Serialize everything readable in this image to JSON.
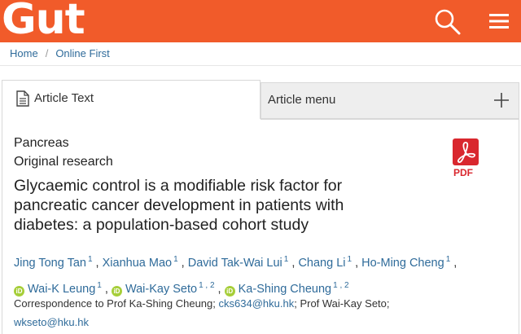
{
  "header": {
    "logo_text": "Gut",
    "brand_color": "#f15b2a",
    "icons": [
      "search-icon",
      "menu-icon"
    ]
  },
  "breadcrumb": {
    "items": [
      {
        "label": "Home"
      },
      {
        "label": "Online First"
      }
    ],
    "separator": "/"
  },
  "tabs": {
    "article_text": "Article Text",
    "article_menu": "Article menu"
  },
  "article": {
    "subject": "Pancreas",
    "type": "Original research",
    "title": "Glycaemic control is a modifiable risk factor for pancreatic cancer development in patients with diabetes: a population-based cohort study",
    "pdf_label": "PDF",
    "authors": [
      {
        "name": "Jing Tong Tan",
        "affil": "1",
        "orcid": false
      },
      {
        "name": "Xianhua Mao",
        "affil": "1",
        "orcid": false
      },
      {
        "name": "David Tak-Wai Lui",
        "affil": "1",
        "orcid": false
      },
      {
        "name": "Chang Li",
        "affil": "1",
        "orcid": false
      },
      {
        "name": "Ho-Ming Cheng",
        "affil": "1",
        "orcid": false
      },
      {
        "name": "Wai-K Leung",
        "affil": "1",
        "orcid": true
      },
      {
        "name": "Wai-Kay Seto",
        "affil": "1 , 2",
        "orcid": true
      },
      {
        "name": "Ka-Shing Cheung",
        "affil": "1 , 2",
        "orcid": true
      }
    ],
    "correspondence": {
      "prefix": "Correspondence to Prof Ka-Shing Cheung;",
      "email1": "cks634@hku.hk",
      "middle": "; Prof Wai-Kay Seto;",
      "email2": "wkseto@hku.hk"
    }
  }
}
